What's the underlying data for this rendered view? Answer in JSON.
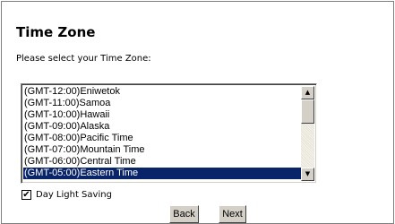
{
  "page": {
    "title": "Time Zone",
    "prompt": "Please select your Time Zone:"
  },
  "timezone_list": {
    "options": [
      "(GMT-12:00)Eniwetok",
      "(GMT-11:00)Samoa",
      "(GMT-10:00)Hawaii",
      "(GMT-09:00)Alaska",
      "(GMT-08:00)Pacific Time",
      "(GMT-07:00)Mountain Time",
      "(GMT-06:00)Central Time",
      "(GMT-05:00)Eastern Time"
    ],
    "selected": "(GMT-05:00)Eastern Time",
    "scroll_up_icon": "triangle-up",
    "scroll_down_icon": "triangle-down"
  },
  "daylight_saving": {
    "label": "Day Light Saving",
    "checked": true,
    "check_mark": "✔"
  },
  "buttons": {
    "back_label": "Back",
    "next_label": "Next"
  },
  "colors": {
    "selection_bg": "#0a246a",
    "selection_fg": "#ffffff",
    "button_face": "#d4d0c8"
  }
}
